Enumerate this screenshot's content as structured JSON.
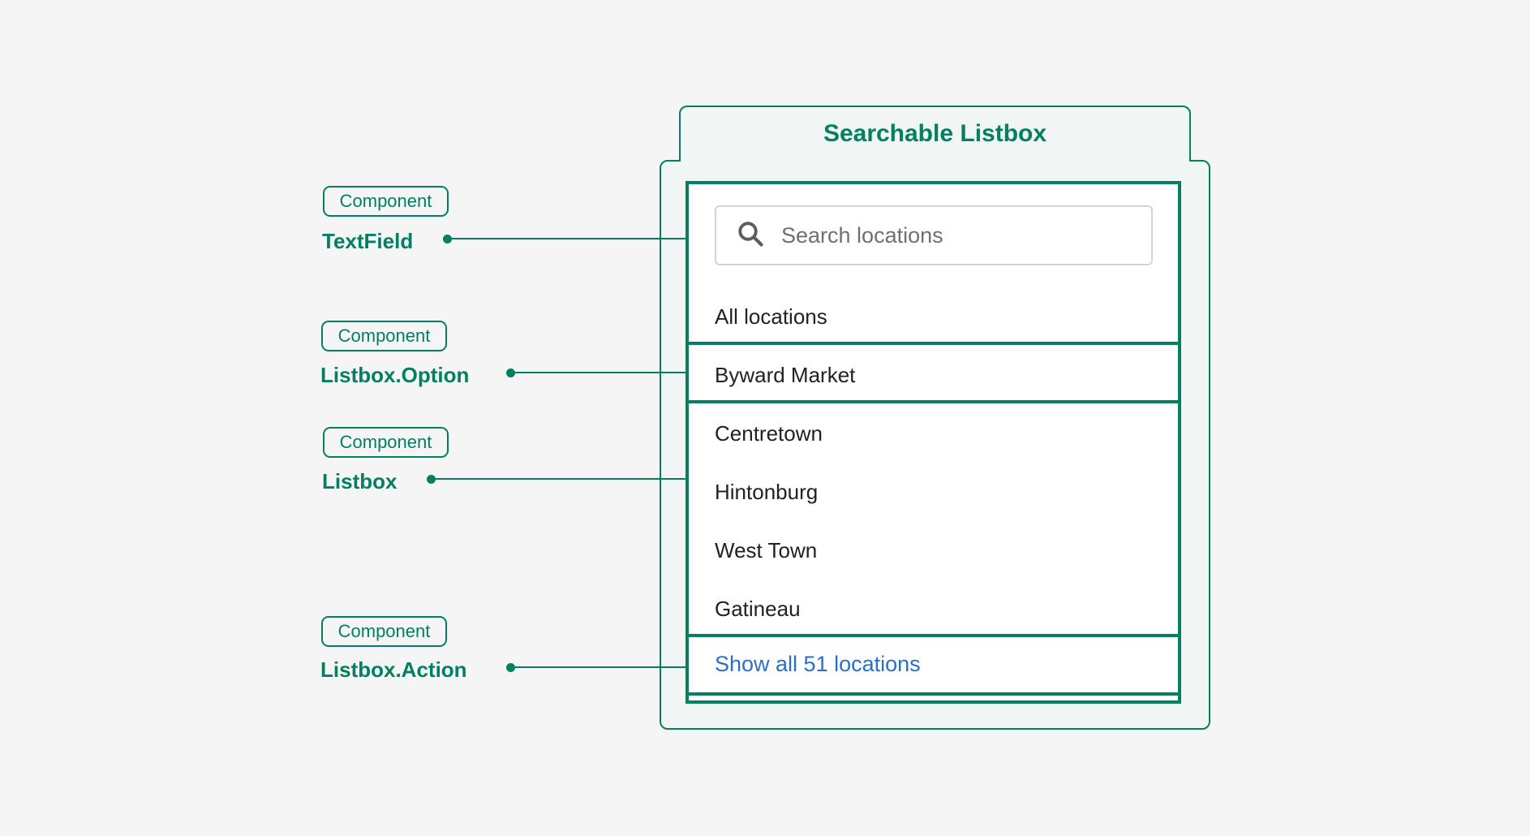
{
  "title": "Searchable Listbox",
  "search": {
    "placeholder": "Search locations",
    "icon": "search-icon"
  },
  "options": [
    "All locations",
    "Byward Market",
    "Centretown",
    "Hintonburg",
    "West Town",
    "Gatineau"
  ],
  "action": "Show all 51 locations",
  "annotations": [
    {
      "badge": "Component",
      "name": "TextField"
    },
    {
      "badge": "Component",
      "name": "Listbox.Option"
    },
    {
      "badge": "Component",
      "name": "Listbox"
    },
    {
      "badge": "Component",
      "name": "Listbox.Action"
    }
  ],
  "colors": {
    "accent": "#008060",
    "link": "#2c6ecb",
    "panel": "#f1f6f4"
  }
}
